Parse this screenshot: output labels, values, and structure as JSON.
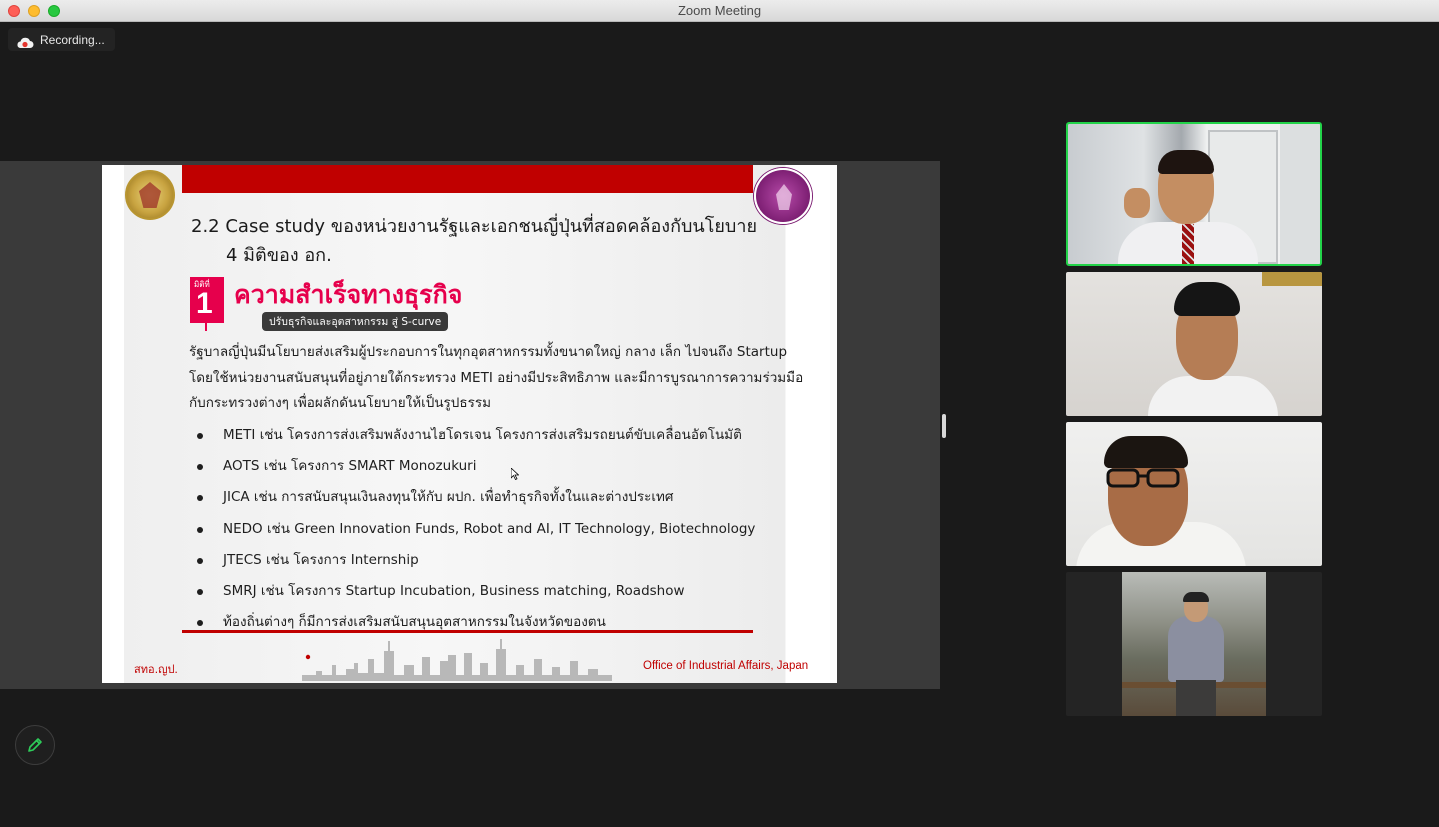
{
  "window": {
    "title": "Zoom Meeting"
  },
  "recording": {
    "label": "Recording..."
  },
  "slide": {
    "title_line1": "2.2  Case study ของหน่วยงานรัฐและเอกชนญี่ปุ่นที่สอดคล้องกับนโยบาย",
    "title_line2": "4 มิติของ อก.",
    "dimension": {
      "small_label": "มิติที่",
      "number": "1",
      "heading": "ความสำเร็จทางธุรกิจ",
      "subheading": "ปรับธุรกิจและอุตสาหกรรม สู่ S-curve"
    },
    "paragraph": [
      "รัฐบาลญี่ปุ่นมีนโยบายส่งเสริมผู้ประกอบการในทุกอุตสาหกรรมทั้งขนาดใหญ่ กลาง เล็ก ไปจนถึง Startup",
      "โดยใช้หน่วยงานสนับสนุนที่อยู่ภายใต้กระทรวง METI อย่างมีประสิทธิภาพ และมีการบูรณาการความร่วมมือ",
      "กับกระทรวงต่างๆ เพื่อผลักดันนโยบายให้เป็นรูปธรรม"
    ],
    "bullets": [
      "METI เช่น โครงการส่งเสริมพลังงานไฮโดรเจน โครงการส่งเสริมรถยนต์ขับเคลื่อนอัตโนมัติ",
      "AOTS เช่น โครงการ SMART Monozukuri",
      "JICA เช่น การสนับสนุนเงินลงทุนให้กับ ผปก. เพื่อทำธุรกิจทั้งในและต่างประเทศ",
      "NEDO เช่น Green Innovation Funds, Robot and AI, IT Technology, Biotechnology",
      "JTECS เช่น โครงการ Internship",
      "SMRJ เช่น โครงการ Startup Incubation, Business matching, Roadshow",
      "ท้องถิ่นต่างๆ ก็มีการส่งเสริมสนับสนุนอุตสาหกรรมในจังหวัดของตน"
    ],
    "footer_left": "สทอ.ญป.",
    "footer_right": "Office of Industrial Affairs, Japan"
  },
  "colors": {
    "slide_red": "#c00000",
    "heading_pink": "#e6004c",
    "active_speaker_border": "#22d349"
  },
  "icons": {
    "recording": "cloud-record-icon",
    "annotate": "pencil-icon"
  }
}
